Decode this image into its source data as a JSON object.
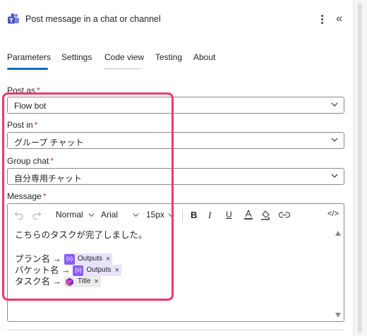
{
  "header": {
    "title": "Post message in a chat or channel",
    "icon": "teams-icon",
    "more_icon": "more-vertical-icon",
    "collapse_icon": "double-chevron-left-icon",
    "collapse_glyph": "«"
  },
  "tabs": [
    {
      "label": "Parameters",
      "active": true
    },
    {
      "label": "Settings",
      "active": false
    },
    {
      "label": "Code view",
      "active": false
    },
    {
      "label": "Testing",
      "active": false
    },
    {
      "label": "About",
      "active": false
    }
  ],
  "fields": {
    "post_as": {
      "label": "Post as",
      "required_mark": "*",
      "value": "Flow bot"
    },
    "post_in": {
      "label": "Post in",
      "required_mark": "*",
      "value": "グループ チャット"
    },
    "group_chat": {
      "label": "Group chat",
      "required_mark": "*",
      "value": "自分専用チャット"
    },
    "message": {
      "label": "Message",
      "required_mark": "*"
    }
  },
  "editor_toolbar": {
    "undo_icon": "undo-icon",
    "redo_icon": "redo-icon",
    "paragraph_style": "Normal",
    "font": "Arial",
    "font_size": "15px",
    "bold": "B",
    "italic": "I",
    "underline": "U",
    "font_color_icon": "font-color-icon",
    "highlight_icon": "highlight-color-icon",
    "link_icon": "link-icon",
    "code_view_icon": "code-view-icon",
    "code_glyph": "</>"
  },
  "message_content": {
    "intro": "こちらのタスクが完了しました。",
    "lines": [
      {
        "label": "プラン名 →",
        "token": "Outputs",
        "token_type": "expression"
      },
      {
        "label": "バケット名 →",
        "token": "Outputs",
        "token_type": "expression"
      },
      {
        "label": "タスク名 →",
        "token": "Title",
        "token_type": "planner"
      }
    ],
    "token_remove_glyph": "×",
    "expression_glyph": "{x}"
  },
  "colors": {
    "accent": "#0f6cbd",
    "highlight_box": "#f0386b",
    "required": "#c4314b",
    "token_bg": "#e8e2fb",
    "token_icon": "#8a5cf5"
  }
}
